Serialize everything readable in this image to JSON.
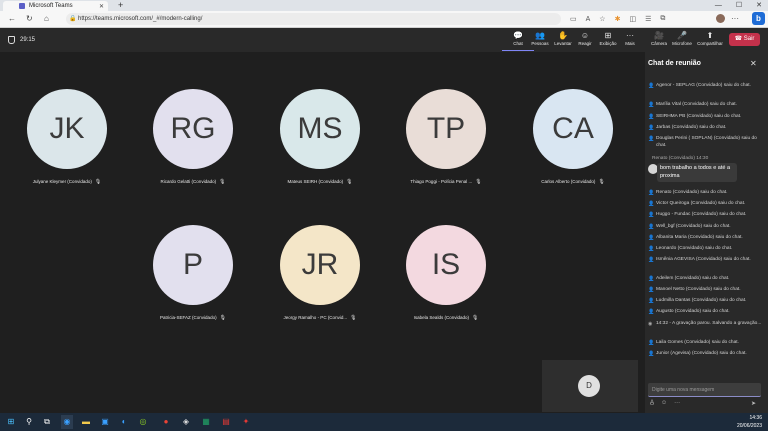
{
  "browser": {
    "tab_title": "Microsoft Teams",
    "new_tab": "+",
    "url": "https://teams.microsoft.com/_#/modern-calling/",
    "window_controls": [
      "—",
      "☐",
      "✕"
    ]
  },
  "meeting": {
    "timer": "29:15",
    "toolbar": [
      {
        "id": "chat",
        "label": "Chat",
        "glyph": "💬"
      },
      {
        "id": "people",
        "label": "Pessoas",
        "glyph": "👥"
      },
      {
        "id": "raise",
        "label": "Levantar",
        "glyph": "✋"
      },
      {
        "id": "react",
        "label": "Reagir",
        "glyph": "☺"
      },
      {
        "id": "view",
        "label": "Exibição",
        "glyph": "⊞"
      },
      {
        "id": "more",
        "label": "Mais",
        "glyph": "···"
      },
      {
        "id": "camera",
        "label": "Câmera",
        "glyph": "🎥"
      },
      {
        "id": "mic",
        "label": "Microfone",
        "glyph": "🎤"
      },
      {
        "id": "share",
        "label": "Compartilhar",
        "glyph": "⬆"
      }
    ],
    "leave_label": "Sair",
    "participants": [
      {
        "initials": "JK",
        "name": "Julyane Kleymer (Convidado)",
        "color": "#dbe6ea"
      },
      {
        "initials": "RG",
        "name": "Ricardo Gelatti (Convidado)",
        "color": "#e2e0ee"
      },
      {
        "initials": "MS",
        "name": "Mateus SEIRH (Convidado)",
        "color": "#d9e8ea"
      },
      {
        "initials": "TP",
        "name": "Thiago Poggi - Polícia Penal ...",
        "color": "#e9ddd7"
      },
      {
        "initials": "CA",
        "name": "Carlos Alberto (Convidado)",
        "color": "#d9e6f2"
      },
      {
        "initials": "P",
        "name": "Patricia-SEFAZ (Convidado)",
        "color": "#e2e0ee"
      },
      {
        "initials": "JR",
        "name": "Jeorgy Ramalho - PC (Convid...",
        "color": "#f4e6c8"
      },
      {
        "initials": "IS",
        "name": "Isabela Sealds (Convidado)",
        "color": "#f3d9e0"
      }
    ],
    "self_initial": "D"
  },
  "chat": {
    "title": "Chat de reunião",
    "messages_top": [
      {
        "icon": "person-leave",
        "text": "Agenor - SEPLAG (Convidado) saiu do chat."
      },
      {
        "icon": "person-leave",
        "text": "Marília Vital (Convidado) saiu do chat."
      },
      {
        "icon": "person-leave",
        "text": "SEIRHMA PB (Convidado) saiu do chat."
      },
      {
        "icon": "person-leave",
        "text": "Jarbas (Convidado) saiu do chat."
      },
      {
        "icon": "person-leave",
        "text": "Douglas Perini ( SOPLAN) (Convidado) saiu do chat."
      }
    ],
    "renato_header": "Renato (Convidado)  14:30",
    "renato_message": "bom trabalho a todos e até a proxima",
    "messages_bottom": [
      {
        "icon": "person-leave",
        "text": "Renato (Convidado) saiu do chat."
      },
      {
        "icon": "person-leave",
        "text": "Victor Queiroga (Convidado) saiu do chat."
      },
      {
        "icon": "person-leave",
        "text": "Huggo - Fundac (Convidado) saiu do chat."
      },
      {
        "icon": "person-leave",
        "text": "Well_bgf (Convidado) saiu do chat."
      },
      {
        "icon": "person-leave",
        "text": "Albanita Maria (Convidado) saiu do chat."
      },
      {
        "icon": "person-leave",
        "text": "Leonardo (Convidado) saiu do chat."
      },
      {
        "icon": "person-leave",
        "text": "Ismênia AGEVISA (Convidado) saiu do chat."
      },
      {
        "icon": "person-leave",
        "text": "Adeilem (Convidado) saiu do chat."
      },
      {
        "icon": "person-leave",
        "text": "Manoel Netto (Convidado) saiu do chat."
      },
      {
        "icon": "person-leave",
        "text": "Ludmilla Dantas (Convidado) saiu do chat."
      },
      {
        "icon": "person-leave",
        "text": "Augusto (Convidado) saiu do chat."
      },
      {
        "icon": "record",
        "text": "14:32 - A gravação parou. Salvando a gravação..."
      },
      {
        "icon": "person-leave",
        "text": "Laila Gomes (Convidado) saiu do chat."
      },
      {
        "icon": "person-leave",
        "text": "Junior (Agevisa) (Convidado) saiu do chat."
      }
    ],
    "compose_placeholder": "Digite uma nova mensagem"
  },
  "taskbar": {
    "time": "14:36",
    "date": "20/06/2023"
  },
  "colors": {
    "background": "#1f1f1f",
    "panel": "#292929",
    "leave": "#c4314b",
    "accent": "#7f85f5"
  }
}
